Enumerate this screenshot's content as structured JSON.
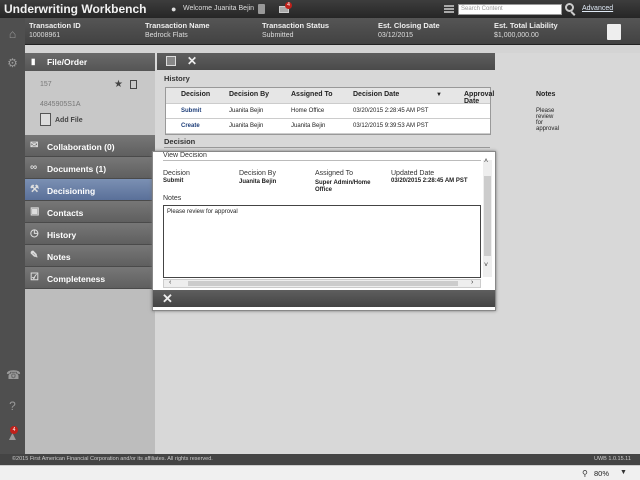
{
  "app": {
    "title": "Underwriting Workbench",
    "welcome": "Welcome Juanita Bejin",
    "mail_count": "4",
    "search_placeholder": "Search Content",
    "advanced_label": "Advanced"
  },
  "transaction": {
    "id_label": "Transaction ID",
    "id_value": "10008961",
    "name_label": "Transaction Name",
    "name_value": "Bedrock Flats",
    "status_label": "Transaction Status",
    "status_value": "Submitted",
    "closing_label": "Est. Closing Date",
    "closing_value": "03/12/2015",
    "liability_label": "Est. Total Liability",
    "liability_value": "$1,000,000.00"
  },
  "sidebar": {
    "file_order_label": "File/Order",
    "file_number_1": "157",
    "file_number_2": "4845905S1A",
    "add_file_label": "Add File",
    "items": [
      {
        "label": "Collaboration (0)"
      },
      {
        "label": "Documents (1)"
      },
      {
        "label": "Decisioning"
      },
      {
        "label": "Contacts"
      },
      {
        "label": "History"
      },
      {
        "label": "Notes"
      },
      {
        "label": "Completeness"
      }
    ]
  },
  "rail": {
    "badge_count": "4"
  },
  "history": {
    "title": "History",
    "columns": [
      "Decision",
      "Decision By",
      "Assigned To",
      "Decision Date",
      "Approval Date",
      "Notes"
    ],
    "rows": [
      {
        "decision": "Submit",
        "by": "Juanita Bejin",
        "assigned": "Home Office",
        "date": "03/20/2015 2:28:45 AM PST",
        "approval": "",
        "notes": "Please review for approval"
      },
      {
        "decision": "Create",
        "by": "Juanita Bejin",
        "assigned": "Juanita Bejin",
        "date": "03/12/2015 9:39:53 AM PST",
        "approval": "",
        "notes": ""
      }
    ]
  },
  "decision_section": {
    "title": "Decision"
  },
  "modal": {
    "title": "View Decision",
    "decision_label": "Decision",
    "decision_value": "Submit",
    "by_label": "Decision By",
    "by_value": "Juanita Bejin",
    "assigned_label": "Assigned To",
    "assigned_value_1": "Super Admin/Home",
    "assigned_value_2": "Office",
    "updated_label": "Updated Date",
    "updated_value": "03/20/2015 2:28:45 AM PST",
    "notes_label": "Notes",
    "notes_value": "Please review for approval"
  },
  "footer": {
    "copyright": "©2015 First American Financial Corporation and/or its affiliates. All rights reserved.",
    "version": "UWB 1.0.15.11"
  },
  "browser": {
    "zoom": "80%"
  }
}
